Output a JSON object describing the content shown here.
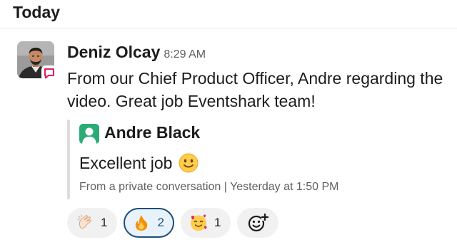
{
  "day_label": "Today",
  "message": {
    "sender": "Deniz Olcay",
    "time": "8:29 AM",
    "body": "From our Chief Product Officer, Andre regarding the video. Great job Eventshark team!",
    "avatar_icon": "person-photo",
    "badge_icon": "speech-bubble-icon"
  },
  "quote": {
    "author": "Andre Black",
    "text": "Excellent job",
    "emoji": "slightly-smiling-face",
    "meta": "From a private conversation | Yesterday at 1:50 PM",
    "avatar_icon": "default-user-avatar",
    "avatar_color": "#2bac76"
  },
  "reactions": [
    {
      "emoji": "clapping-hands",
      "count": "1",
      "active": false
    },
    {
      "emoji": "fire",
      "count": "2",
      "active": true
    },
    {
      "emoji": "smiling-face-with-hearts",
      "count": "1",
      "active": false
    }
  ],
  "add_reaction_icon": "add-emoji-icon",
  "colors": {
    "active_reaction_border": "#1d4f7a",
    "active_reaction_bg": "#e8f2fb",
    "reaction_bg": "#f1f1f1",
    "meta_text": "#616061"
  }
}
